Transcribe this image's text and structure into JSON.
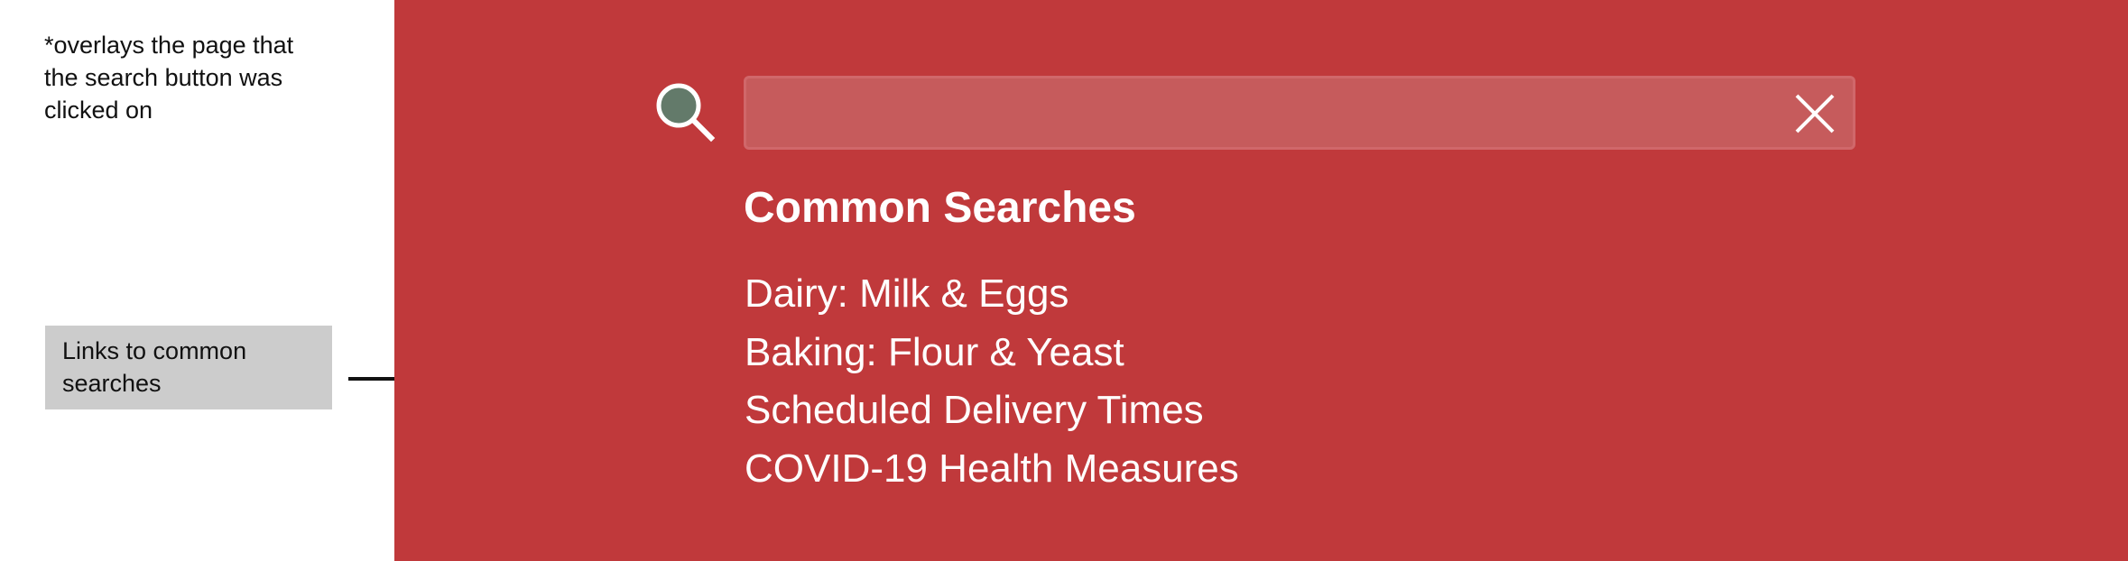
{
  "annotations": {
    "overlay_note": "*overlays the page that the search button was clicked on",
    "links_callout": "Links to common searches"
  },
  "search": {
    "input_value": "",
    "placeholder": "",
    "icon": "search-icon",
    "clear_icon": "close-icon"
  },
  "common_searches": {
    "heading": "Common Searches",
    "links": [
      {
        "label": "Dairy: Milk & Eggs"
      },
      {
        "label": "Baking: Flour & Yeast"
      },
      {
        "label": "Scheduled Delivery Times"
      },
      {
        "label": "COVID-19 Health Measures"
      }
    ]
  },
  "colors": {
    "overlay_background": "#c0393b",
    "search_field_background": "#c65b5c",
    "search_icon_fill": "#637a6a",
    "text": "#ffffff",
    "callout_background": "#cccccc"
  }
}
